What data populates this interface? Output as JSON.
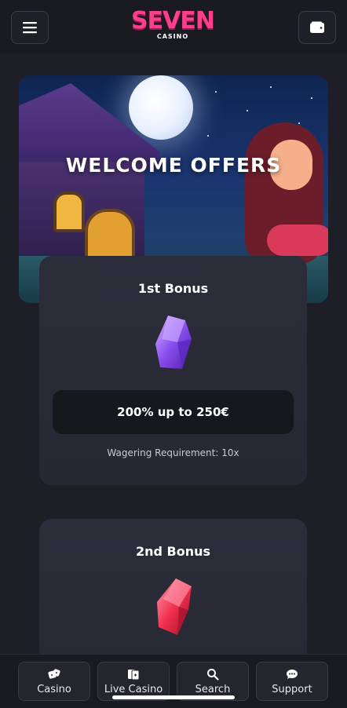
{
  "header": {
    "logo_text": "SEVEN",
    "logo_subtext": "CASINO",
    "menu_icon": "hamburger-menu-icon",
    "wallet_icon": "wallet-icon"
  },
  "hero": {
    "title": "WELCOME OFFERS"
  },
  "bonuses": [
    {
      "title": "1st Bonus",
      "gem_icon": "purple-gem-icon",
      "amount": "200% up to 250€",
      "wagering": "Wagering Requirement: 10x"
    },
    {
      "title": "2nd Bonus",
      "gem_icon": "red-gem-icon"
    }
  ],
  "bottom_nav": [
    {
      "label": "Casino",
      "icon": "dice-icon"
    },
    {
      "label": "Live Casino",
      "icon": "cards-icon"
    },
    {
      "label": "Search",
      "icon": "search-icon"
    },
    {
      "label": "Support",
      "icon": "chat-bubble-icon"
    }
  ],
  "colors": {
    "background": "#1e1f26",
    "brand_pink": "#ff3e8c",
    "card": "#2c2d3a"
  }
}
